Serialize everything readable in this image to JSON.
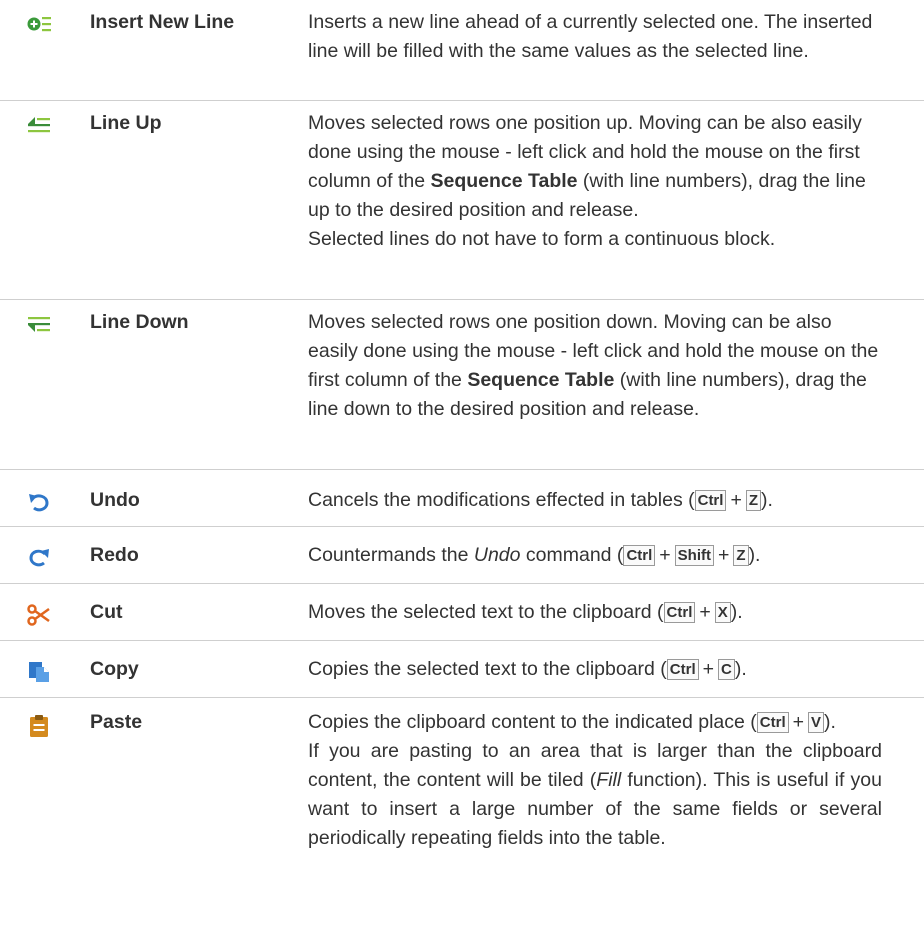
{
  "rows": [
    {
      "name": "Insert New Line",
      "icon": "insert-line-icon",
      "desc": [
        "Inserts a new line ahead of a currently selected one. The inserted line will be filled with the same values as the selected line."
      ]
    },
    {
      "name": "Line Up",
      "icon": "line-up-icon",
      "desc_pre": "Moves selected rows one position up. Moving can be also easily done using the mouse - left click and hold the mouse on the first column of the ",
      "desc_bold": "Sequence Table",
      "desc_post": " (with line numbers), drag the line up to the desired position and release.",
      "desc_extra": "Selected lines do not have to form a continuous block."
    },
    {
      "name": "Line Down",
      "icon": "line-down-icon",
      "desc_pre": "Moves selected rows one position down. Moving can be also easily done using the mouse - left click and hold the mouse on the first column of the ",
      "desc_bold": "Sequence Table",
      "desc_post": " (with line numbers), drag the line down to the desired position and release."
    },
    {
      "name": "Undo",
      "icon": "undo-icon",
      "desc_pre": "Cancels the modifications effected in tables (",
      "keys": [
        "Ctrl",
        "Z"
      ],
      "desc_post": ")."
    },
    {
      "name": "Redo",
      "icon": "redo-icon",
      "desc_pre": "Countermands the ",
      "desc_italic": "Undo",
      "desc_mid": " command (",
      "keys": [
        "Ctrl",
        "Shift",
        "Z"
      ],
      "desc_post": ")."
    },
    {
      "name": "Cut",
      "icon": "scissors-icon",
      "desc_pre": "Moves the selected text to the clipboard (",
      "keys": [
        "Ctrl",
        "X"
      ],
      "desc_post": ")."
    },
    {
      "name": "Copy",
      "icon": "copy-icon",
      "desc_pre": "Copies the selected text to the clipboard (",
      "keys": [
        "Ctrl",
        "C"
      ],
      "desc_post": ")."
    },
    {
      "name": "Paste",
      "icon": "clipboard-icon",
      "desc_pre": "Copies the clipboard content to the indicated place (",
      "keys": [
        "Ctrl",
        "V"
      ],
      "desc_post": ").",
      "desc_extra_pre": "If you are pasting to an area that is larger than the clipboard content, the content will be tiled (",
      "desc_extra_italic": "Fill",
      "desc_extra_post": " function). This is useful if you want to insert a large number of the same fields or several periodically repeating fields into the table."
    }
  ],
  "plus_sign": "+",
  "colors": {
    "green": "#8dc63f",
    "dark_green": "#3a8c3a",
    "blue": "#2f77c9",
    "orange": "#e08a1e",
    "rule": "#cfcfcf"
  }
}
